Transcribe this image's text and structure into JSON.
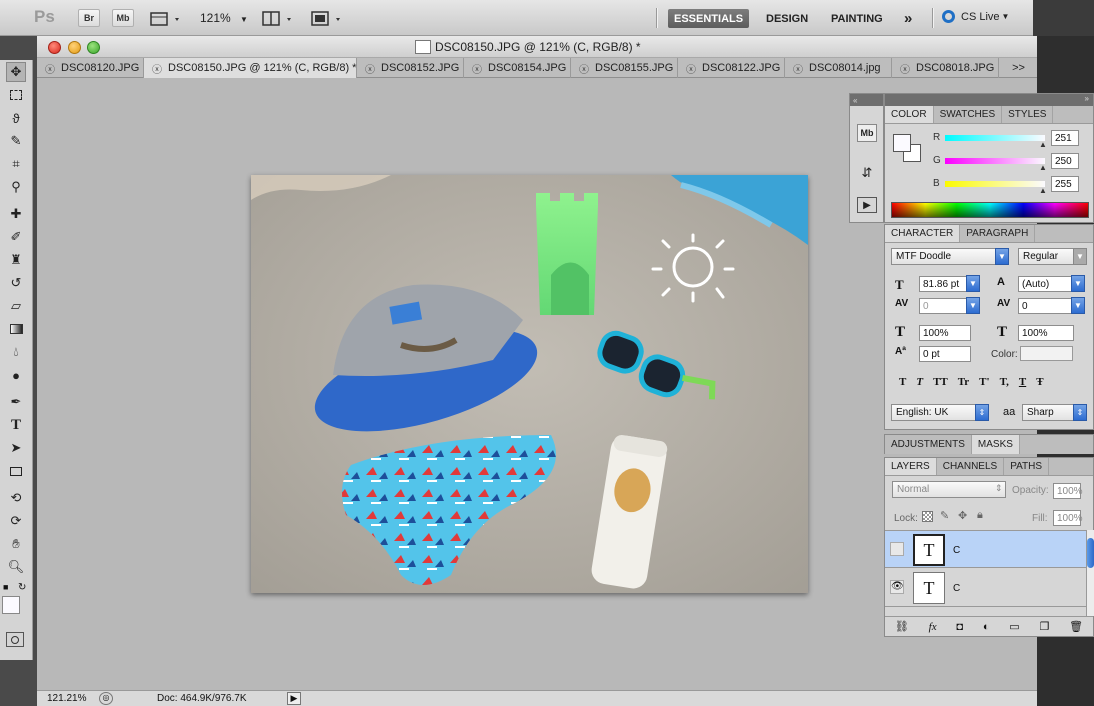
{
  "app": {
    "logo": "Ps",
    "bridge_label": "Br",
    "minibridge_label": "Mb",
    "zoom_level": "121%",
    "workspaces": [
      "ESSENTIALS",
      "DESIGN",
      "PAINTING"
    ],
    "more_label": "»",
    "cs_live_label": "CS Live"
  },
  "document": {
    "title": "DSC08150.JPG @ 121% (C, RGB/8) *",
    "tabs": [
      {
        "label": "DSC08120.JPG",
        "active": false
      },
      {
        "label": "DSC08150.JPG @ 121% (C, RGB/8) *",
        "active": true
      },
      {
        "label": "DSC08152.JPG",
        "active": false
      },
      {
        "label": "DSC08154.JPG",
        "active": false
      },
      {
        "label": "DSC08155.JPG",
        "active": false
      },
      {
        "label": "DSC08122.JPG",
        "active": false
      },
      {
        "label": "DSC08014.jpg",
        "active": false
      },
      {
        "label": "DSC08018.JPG",
        "active": false
      }
    ],
    "tabs_overflow": ">>"
  },
  "status": {
    "zoom": "121.21%",
    "doc_size": "Doc: 464.9K/976.7K"
  },
  "color_panel": {
    "tabs": [
      "COLOR",
      "SWATCHES",
      "STYLES"
    ],
    "r_label": "R",
    "g_label": "G",
    "b_label": "B",
    "r_value": "251",
    "g_value": "250",
    "b_value": "255",
    "r": 251,
    "g": 250,
    "b": 255
  },
  "mini_dock": {
    "mb_label": "Mb"
  },
  "character_panel": {
    "tabs": [
      "CHARACTER",
      "PARAGRAPH"
    ],
    "font_family": "MTF Doodle",
    "font_style": "Regular",
    "font_size": "81.86 pt",
    "leading": "(Auto)",
    "kerning": "0",
    "tracking": "0",
    "vertical_scale": "100%",
    "horizontal_scale": "100%",
    "baseline_shift": "0 pt",
    "color_label": "Color:",
    "style_buttons": [
      "T",
      "T",
      "TT",
      "Tr",
      "T'",
      "T,",
      "T",
      "Ŧ"
    ],
    "language": "English: UK",
    "aa_glyph": "aa",
    "antialias": "Sharp"
  },
  "adjustments_panel": {
    "tabs": [
      "ADJUSTMENTS",
      "MASKS"
    ]
  },
  "layers_panel": {
    "tabs": [
      "LAYERS",
      "CHANNELS",
      "PATHS"
    ],
    "blend_mode": "Normal",
    "opacity_label": "Opacity:",
    "opacity": "100%",
    "lock_label": "Lock:",
    "fill_label": "Fill:",
    "fill": "100%",
    "layers": [
      {
        "name": "C",
        "thumb": "T",
        "visible": false,
        "selected": true
      },
      {
        "name": "C",
        "thumb": "T",
        "visible": true,
        "selected": false
      }
    ]
  },
  "colors": {
    "selection_blue": "#b9d3f7",
    "accent_blue": "#3a78d8",
    "sand": "#b7b1a7"
  }
}
